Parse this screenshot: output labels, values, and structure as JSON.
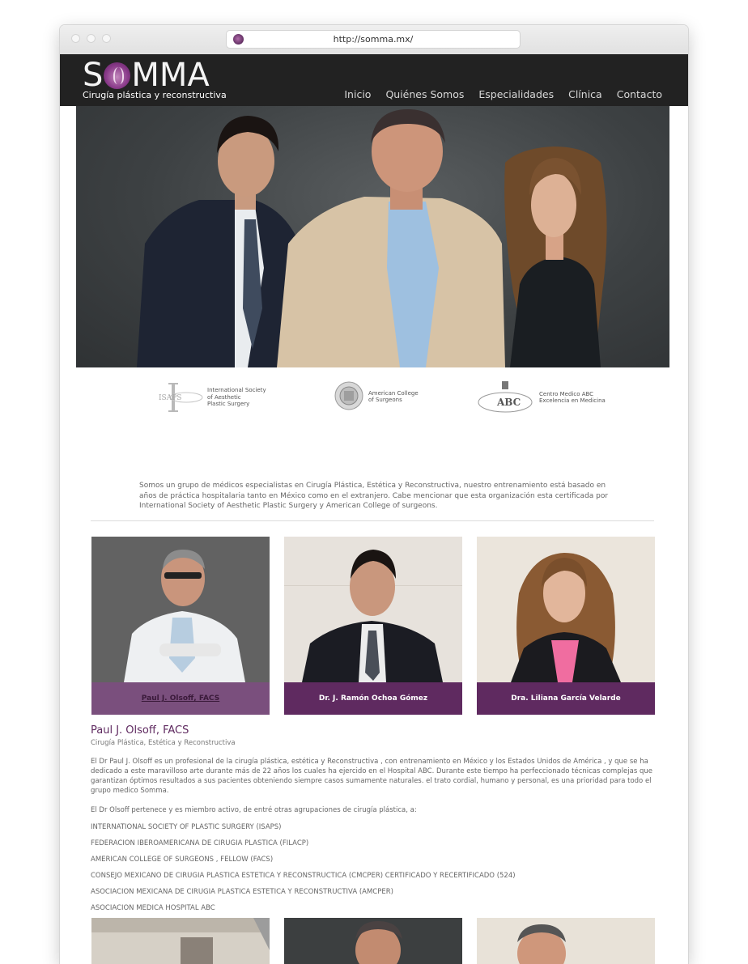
{
  "browser": {
    "url": "http://somma.mx/"
  },
  "site": {
    "logo_text": "S",
    "logo_text_rest": "MMA",
    "tagline": "Cirugía plástica y reconstructiva",
    "nav": [
      "Inicio",
      "Quiénes Somos",
      "Especialidades",
      "Clínica",
      "Contacto"
    ]
  },
  "orgs": [
    {
      "mark": "ISAPS",
      "text": [
        "International Society",
        "of Aesthetic",
        "Plastic Surgery"
      ]
    },
    {
      "mark": "",
      "text": [
        "American College",
        "of Surgeons"
      ]
    },
    {
      "mark": "ABC",
      "text": [
        "Centro Medico ABC",
        "Excelencia en Medicina"
      ]
    }
  ],
  "intro": "Somos un grupo de médicos especialistas en Cirugía Plástica, Estética y Reconstructiva, nuestro entrenamiento está basado en años de práctica hospitalaria tanto en México como en el extranjero. Cabe mencionar que esta organización esta certificada por International Society of Aesthetic Plastic Surgery y American College of surgeons.",
  "doctors": [
    {
      "name": "Paul J. Olsoff, FACS"
    },
    {
      "name": "Dr. J. Ramón Ochoa Gómez"
    },
    {
      "name": "Dra. Liliana García Velarde"
    }
  ],
  "bio": {
    "name": "Paul J. Olsoff, FACS",
    "role": "Cirugía Plástica, Estética y Reconstructiva",
    "p1": "El Dr Paul J. Olsoff es un profesional de la cirugía plástica, estética y Reconstructiva , con entrenamiento en México y los Estados Unidos de América , y que se ha dedicado a este maravilloso arte durante más de 22 años los cuales ha ejercido en el Hospital ABC. Durante este tiempo ha perfeccionado técnicas complejas que garantizan óptimos resultados a sus pacientes obteniendo siempre casos sumamente naturales. el trato cordial, humano y personal, es una prioridad para todo el grupo medico Somma.",
    "p2": "El Dr Olsoff pertenece y es miembro activo, de entré otras agrupaciones de cirugía plástica, a:",
    "memberships": [
      "INTERNATIONAL SOCIETY OF PLASTIC SURGERY (ISAPS)",
      "FEDERACION IBEROAMERICANA DE CIRUGIA PLASTICA (FILACP)",
      "AMERICAN COLLEGE OF SURGEONS , FELLOW (FACS)",
      "CONSEJO MEXICANO DE CIRUGIA PLASTICA ESTETICA Y RECONSTRUCTICA (CMCPER) CERTIFICADO Y RECERTIFICADO (524)",
      "ASOCIACION MEXICANA DE CIRUGIA PLASTICA ESTETICA Y RECONSTRUCTIVA (AMCPER)",
      "ASOCIACION MEDICA HOSPITAL ABC"
    ]
  },
  "colors": {
    "brand": "#5f2a60",
    "header": "#222222"
  }
}
